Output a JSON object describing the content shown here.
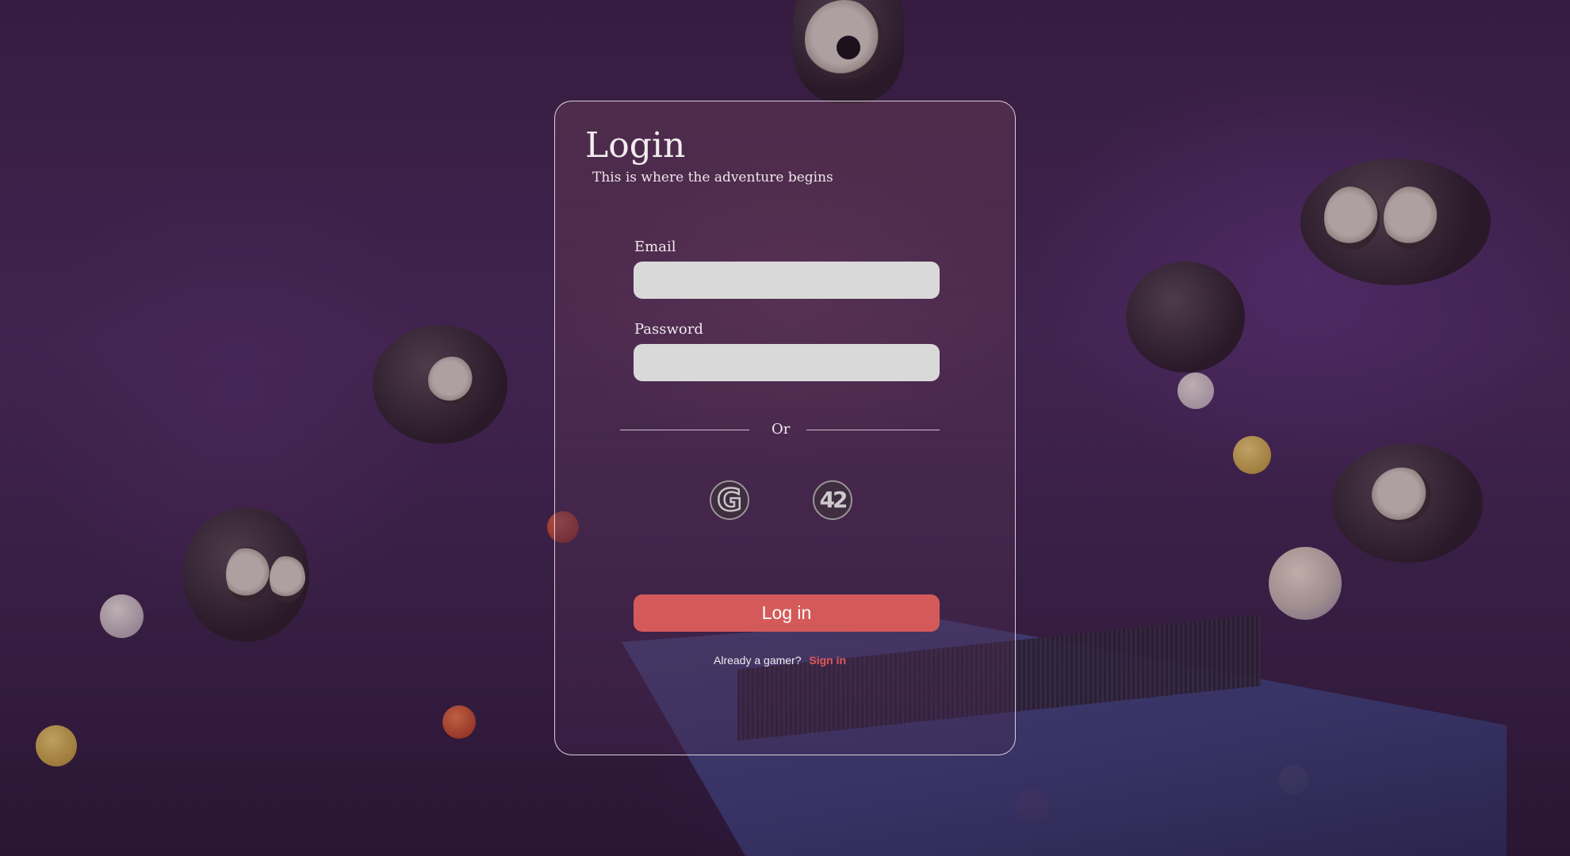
{
  "login": {
    "title": "Login",
    "subtitle": "This is where the adventure begins",
    "email_label": "Email",
    "email_value": "",
    "password_label": "Password",
    "password_value": "",
    "divider_text": "Or",
    "oauth": [
      {
        "icon": "google-icon",
        "glyph": "G"
      },
      {
        "icon": "42-icon",
        "glyph": "42"
      }
    ],
    "submit_label": "Log in",
    "footer_text": "Already a gamer?",
    "signin_label": "Sign in"
  },
  "colors": {
    "accent": "#d45a5a",
    "link": "#e0585b",
    "input_bg": "#d9d9d9"
  }
}
